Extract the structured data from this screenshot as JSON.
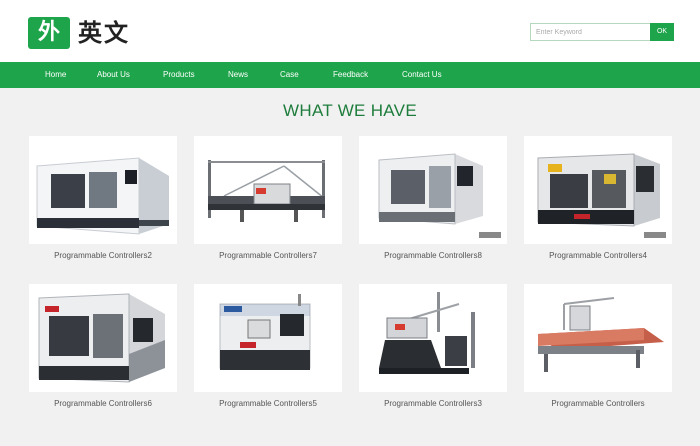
{
  "header": {
    "logo_glyph": "外",
    "logo_text": "英文",
    "search": {
      "placeholder": "Enter Keyword",
      "button_label": "OK"
    }
  },
  "nav": {
    "items": [
      {
        "label": "Home"
      },
      {
        "label": "About Us"
      },
      {
        "label": "Products"
      },
      {
        "label": "News"
      },
      {
        "label": "Case"
      },
      {
        "label": "Feedback"
      },
      {
        "label": "Contact Us"
      }
    ]
  },
  "section": {
    "title": "WHAT WE HAVE"
  },
  "products": [
    {
      "name": "Programmable Controllers2"
    },
    {
      "name": "Programmable Controllers7"
    },
    {
      "name": "Programmable Controllers8"
    },
    {
      "name": "Programmable Controllers4"
    },
    {
      "name": "Programmable Controllers6"
    },
    {
      "name": "Programmable Controllers5"
    },
    {
      "name": "Programmable Controllers3"
    },
    {
      "name": "Programmable Controllers"
    }
  ],
  "colors": {
    "brand_green": "#1ea44a",
    "title_green": "#1e7d3c",
    "background": "#f1f1f1"
  }
}
